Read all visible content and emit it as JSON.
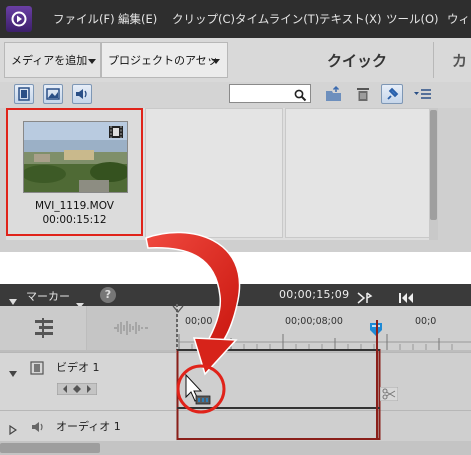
{
  "menu": {
    "items": [
      "ファイル(F)",
      "編集(E)",
      "クリップ(C)",
      "タイムライン(T)",
      "テキスト(X)",
      "ツール(O)",
      "ウィ"
    ]
  },
  "tabs": {
    "add_media": "メディアを追加",
    "project_assets": "プロジェクトのアセット",
    "quick": "クイック",
    "next_partial": "カ"
  },
  "toolbar": {
    "icons": [
      "film-filter-icon",
      "image-filter-icon",
      "audio-filter-icon",
      "new-folder-icon",
      "trash-icon",
      "pin-icon",
      "list-options-icon"
    ],
    "search_value": ""
  },
  "media_clip": {
    "name": "MVI_1119.MOV",
    "duration": "00:00:15:12"
  },
  "timeline": {
    "marker_label": "マーカー",
    "help": "?",
    "current_timecode": "00;00;15;09",
    "ruler_labels": [
      "00;00",
      "00;00;08;00",
      "00;0"
    ],
    "tracks": {
      "video_label": "ビデオ 1",
      "audio_label": "オーディオ 1"
    }
  },
  "colors": {
    "accent_red": "#e0231a",
    "menubar": "#2e2e2e",
    "playhead_blue": "#1e8ad6"
  }
}
